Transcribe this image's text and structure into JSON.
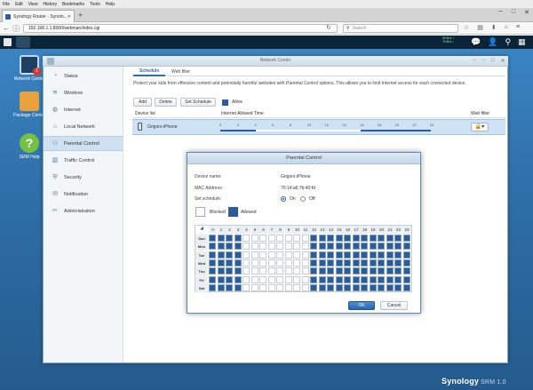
{
  "browser": {
    "menu": [
      "File",
      "Edit",
      "View",
      "History",
      "Bookmarks",
      "Tools",
      "Help"
    ],
    "tab_title": "Synology Router - Synolo...",
    "url": "192.168.1.1:8000/webman/index.cgi",
    "search_placeholder": "Search"
  },
  "taskbar": {
    "status_up": "5KB/s ↑",
    "status_down": "7KB/s ↓"
  },
  "desktop": {
    "icons": [
      {
        "label": "Network Center",
        "badge": "1"
      },
      {
        "label": "Package Center"
      },
      {
        "label": "SRM Help",
        "glyph": "?"
      }
    ],
    "brand": "Synology",
    "brand_suffix": "SRM 1.0"
  },
  "window": {
    "title": "Network Center",
    "sidebar": [
      {
        "label": "Status",
        "icon": "status-icon"
      },
      {
        "label": "Wireless",
        "icon": "wifi-icon"
      },
      {
        "label": "Internet",
        "icon": "globe-icon"
      },
      {
        "label": "Local Network",
        "icon": "house-icon"
      },
      {
        "label": "Parental Control",
        "icon": "family-icon",
        "selected": true
      },
      {
        "label": "Traffic Control",
        "icon": "bars-icon"
      },
      {
        "label": "Security",
        "icon": "shield-icon"
      },
      {
        "label": "Notification",
        "icon": "chat-icon"
      },
      {
        "label": "Administration",
        "icon": "tools-icon"
      }
    ],
    "tabs": [
      "Schedule",
      "Web filter"
    ],
    "description": "Protect your kids from offensive content and potentially harmful websites with Parental Control options. This allows you to limit Internet access for each connected device.",
    "toolbar": {
      "add": "Add",
      "delete": "Delete",
      "set_schedule": "Set Schedule",
      "legend_allow": "Allow"
    },
    "table": {
      "headers": {
        "device": "Device list",
        "allowed": "Internet Allowed Time",
        "webfilter": "Web filter"
      },
      "row": {
        "device": "Grigors-iPhone",
        "hour_labels": [
          "0",
          "2",
          "4",
          "6",
          "8",
          "10",
          "12",
          "14",
          "16",
          "18",
          "20",
          "22",
          "24"
        ],
        "allowed_ranges": [
          [
            0,
            4
          ],
          [
            16,
            24
          ]
        ],
        "filter_glyph": "🔒▾"
      }
    }
  },
  "dialog": {
    "title": "Parental Control",
    "device_name_label": "Device name:",
    "device_name": "Grigors-iPhone",
    "mac_label": "MAC Address:",
    "mac": "70:14:a6:7b:40:fd",
    "schedule_label": "Set schedule:",
    "on_label": "On",
    "off_label": "Off",
    "legend_blocked": "Blocked",
    "legend_allowed": "Allowed",
    "hours": [
      "0",
      "1",
      "2",
      "3",
      "4",
      "5",
      "6",
      "7",
      "8",
      "9",
      "10",
      "11",
      "12",
      "13",
      "14",
      "15",
      "16",
      "17",
      "18",
      "19",
      "20",
      "21",
      "22",
      "23"
    ],
    "days": [
      "Sun",
      "Mon",
      "Tue",
      "Wed",
      "Thu",
      "Fri",
      "Sat"
    ],
    "allowed_hours": [
      0,
      1,
      2,
      3,
      12,
      13,
      14,
      15,
      16,
      17,
      18,
      19,
      20,
      21,
      22,
      23
    ],
    "ok": "OK",
    "cancel": "Cancel"
  }
}
